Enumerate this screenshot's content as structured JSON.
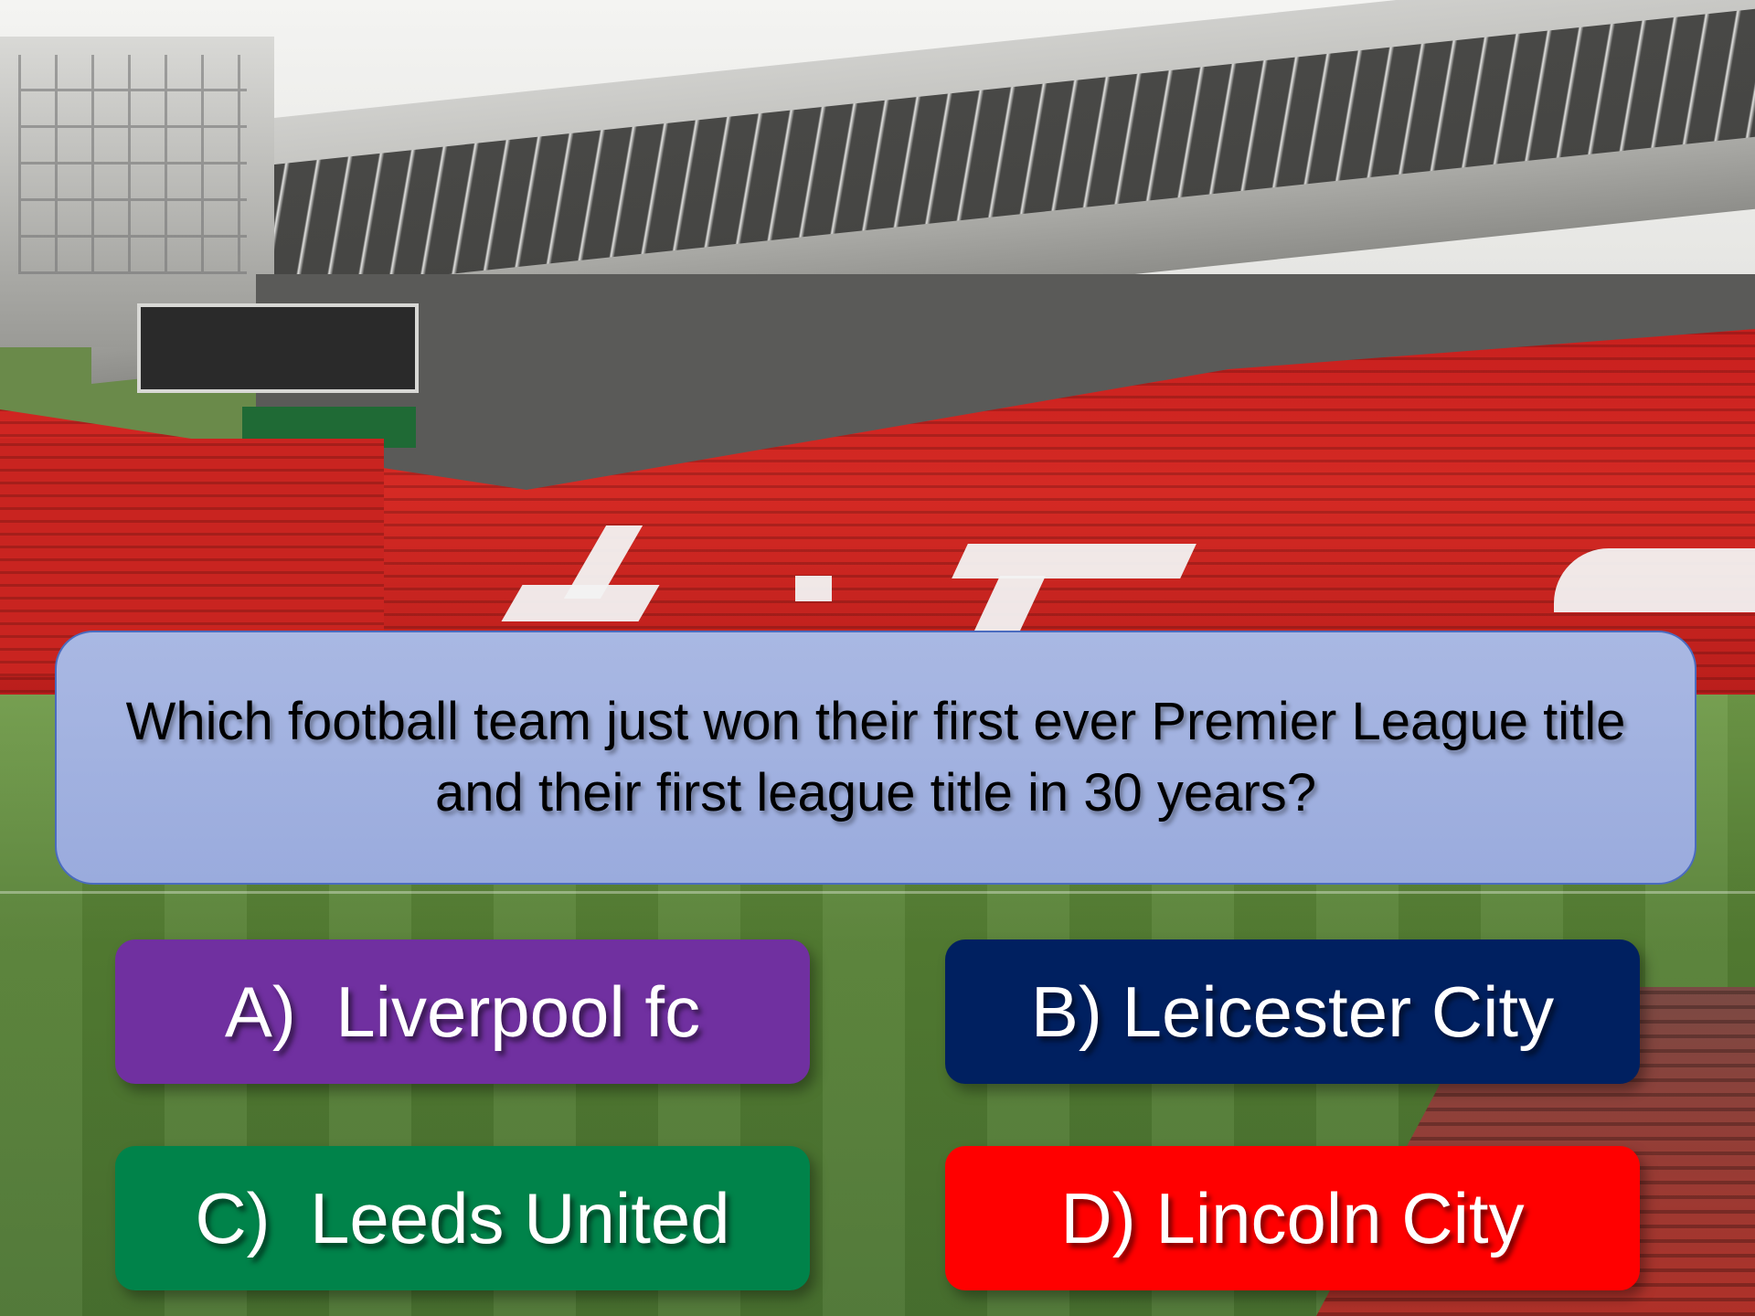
{
  "quiz": {
    "question": "Which football team just won their first ever Premier League title and their first league title in 30 years?",
    "answers": [
      {
        "label": "A)  Liverpool fc",
        "color": "#7030a0"
      },
      {
        "label": "B) Leicester City",
        "color": "#002060"
      },
      {
        "label": "C)  Leeds United",
        "color": "#00834a"
      },
      {
        "label": "D) Lincoln City",
        "color": "#ff0000"
      }
    ]
  },
  "theme": {
    "question_panel_color": "#a3b3e0",
    "question_border_color": "#4a6bbf"
  }
}
